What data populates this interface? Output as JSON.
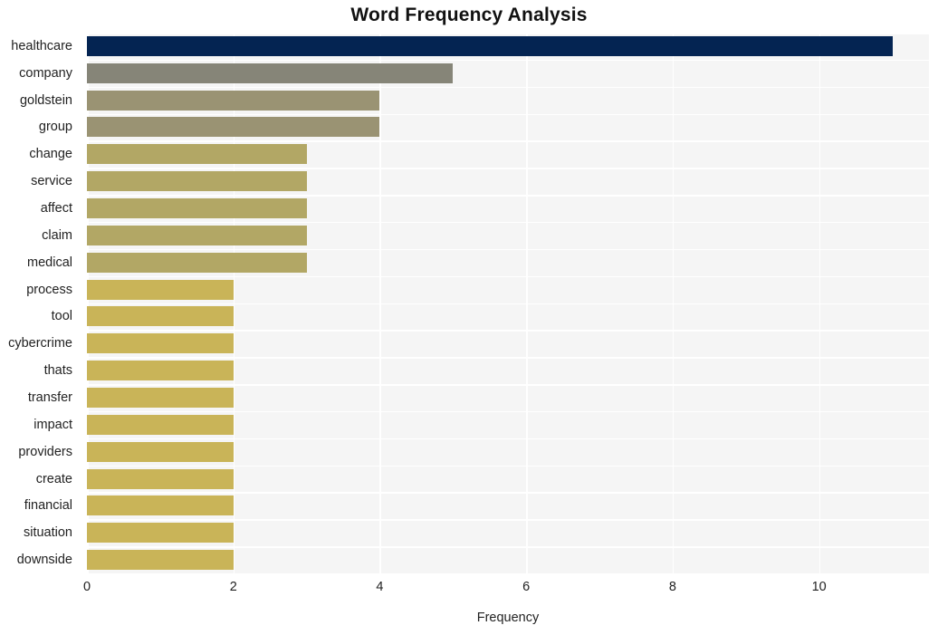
{
  "chart_data": {
    "type": "bar",
    "orientation": "horizontal",
    "title": "Word Frequency Analysis",
    "xlabel": "Frequency",
    "ylabel": "",
    "categories": [
      "healthcare",
      "company",
      "goldstein",
      "group",
      "change",
      "service",
      "affect",
      "claim",
      "medical",
      "process",
      "tool",
      "cybercrime",
      "thats",
      "transfer",
      "impact",
      "providers",
      "create",
      "financial",
      "situation",
      "downside"
    ],
    "values": [
      11,
      5,
      4,
      4,
      3,
      3,
      3,
      3,
      3,
      2,
      2,
      2,
      2,
      2,
      2,
      2,
      2,
      2,
      2,
      2
    ],
    "bar_colors": [
      "#042452",
      "#868578",
      "#9a9373",
      "#9a9373",
      "#b2a765",
      "#b2a765",
      "#b2a765",
      "#b2a765",
      "#b2a765",
      "#c9b458",
      "#c9b458",
      "#c9b458",
      "#c9b458",
      "#c9b458",
      "#c9b458",
      "#c9b458",
      "#c9b458",
      "#c9b458",
      "#c9b458",
      "#c9b458"
    ],
    "xticks": [
      0,
      2,
      4,
      6,
      8,
      10
    ],
    "xlim": [
      0,
      11.5
    ],
    "grid": true,
    "grid_color": "#ffffff",
    "plot_background": "#f5f5f5",
    "legend": null
  }
}
